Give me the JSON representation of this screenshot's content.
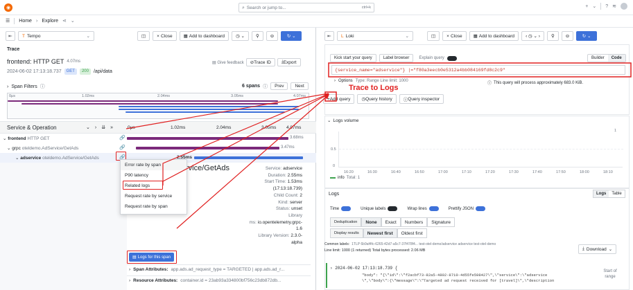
{
  "topbar": {
    "search_placeholder": "Search or jump to...",
    "shortcut": "ctrl+k",
    "plus": "+"
  },
  "nav": {
    "home": "Home",
    "sep": "›",
    "explore": "Explore"
  },
  "left": {
    "datasource": "Tempo",
    "split": "Close",
    "add_dashboard": "Add to dashboard",
    "refresh": "",
    "trace_label": "Trace",
    "trace_title": "frontend: HTTP GET",
    "trace_duration": "4.07ms",
    "trace_date": "2024-06-02 17:13:18.737",
    "method": "GET",
    "status": "200",
    "path": "/api/data",
    "give_feedback": "Give feedback",
    "trace_id": "Trace ID",
    "export": "Export",
    "span_filters": "Span Filters",
    "spans_count": "6 spans",
    "prev": "Prev",
    "next": "Next",
    "mini_ticks": [
      "0μs",
      "1.02ms",
      "2.04ms",
      "3.05ms",
      "4.07ms"
    ],
    "header": "Service & Operation",
    "ticks": [
      "0μs",
      "1.02ms",
      "2.04ms",
      "3.05ms",
      "4.07ms"
    ],
    "rows": [
      {
        "service": "frontend",
        "op": "HTTP GET",
        "dur": "3.68ms"
      },
      {
        "service": "grpc",
        "op": "oteldemo.AdService/GetAds",
        "dur": "3.47ms"
      },
      {
        "service": "adservice",
        "op": "oteldemo.AdService/GetAds",
        "dur": "2.55ms"
      }
    ],
    "menu": [
      "Error rate by span",
      "P90 latency",
      "Related logs",
      "Request rate by service",
      "Request rate by span"
    ],
    "detail_title": "rvice/GetAds",
    "details": [
      {
        "k": "Service:",
        "v": "adservice"
      },
      {
        "k": "Duration:",
        "v": "2.55ms"
      },
      {
        "k": "Start Time:",
        "v": "1.53ms"
      },
      {
        "k": "",
        "v": "(17:13:18.739)"
      },
      {
        "k": "Child Count:",
        "v": "2"
      },
      {
        "k": "Kind:",
        "v": "server"
      },
      {
        "k": "Status:",
        "v": "unset"
      },
      {
        "k": "",
        "v": "Library"
      },
      {
        "k": "ms:",
        "v": "io.opentelemetry.grpc-"
      },
      {
        "k": "",
        "v": "1.6"
      },
      {
        "k": "Library Version:",
        "v": "2.3.0-"
      },
      {
        "k": "",
        "v": "alpha"
      }
    ],
    "logs_btn": "Logs for this span",
    "span_attrs": "Span Attributes:",
    "span_attrs_val": "app.ads.ad_request_type = TARGETED | app.ads.ad_r...",
    "res_attrs": "Resource Attributes:",
    "res_attrs_val": "container.id = 23ab93a334800bf756c23db872db..."
  },
  "right": {
    "datasource": "Loki",
    "close": "Close",
    "add_dashboard": "Add to dashboard",
    "kick_start": "Kick start your query",
    "label_browser": "Label browser",
    "explain": "Explain query",
    "builder": "Builder",
    "code": "Code",
    "query": "{service_name=\"adservice\"} |=\"f80a3eecb0e5312a4bb084169fd8c2c9\"",
    "options": "Options",
    "options_detail": "Type: Range   Line limit: 1000",
    "process_info": "This query will process approximately 683.0 KiB.",
    "add_query": "Add query",
    "query_history": "Query history",
    "query_inspector": "Query inspector",
    "logs_volume": "Logs volume",
    "y_ticks": [
      "1",
      "0.5",
      "0"
    ],
    "x_ticks": [
      "16:20",
      "16:30",
      "16:40",
      "16:50",
      "17:00",
      "17:10",
      "17:20",
      "17:30",
      "17:40",
      "17:50",
      "18:00",
      "18:10"
    ],
    "legend": "info",
    "legend_total": "Total: 1",
    "logs": "Logs",
    "logs_tab": "Logs",
    "table_tab": "Table",
    "time": "Time",
    "unique_labels": "Unique labels",
    "wrap": "Wrap lines",
    "prettify": "Prettify JSON",
    "dedup": "Deduplication",
    "dedup_opts": [
      "None",
      "Exact",
      "Numbers",
      "Signature"
    ],
    "display": "Display results",
    "display_opts": [
      "Newest first",
      "Oldest first"
    ],
    "common_labels": "Common labels:",
    "common_val": "1TLP 6b9af4fc-6265-42d7-a5c7-37f478f4... test-otel-demo/adservice adservice test-otel-demo",
    "line_limit": "Line limit: 1000 (1 returned)   Total bytes processed: 2.06 MB",
    "download": "Download",
    "log_time": "2024-06-02 17:13:18.739 {",
    "log_l1": "\"body\": \"{\\\"id\\\":\\\"f2acbf73-82a5-4802-8710-4d55fe598427\\\",\\\"service\\\":\\\"adservice",
    "log_l2": "\\\",\\\"body\\\":{\\\"message\\\":\\\"Targeted ad request received for [travel]\\\",\\\"description",
    "start_range": "Start of range"
  },
  "annotation": "Trace to Logs",
  "colors": {
    "accent": "#3d71d9",
    "red": "#e02020",
    "purple": "#7b2a7b",
    "green": "#3ea34e",
    "blue": "#3d71d9"
  }
}
